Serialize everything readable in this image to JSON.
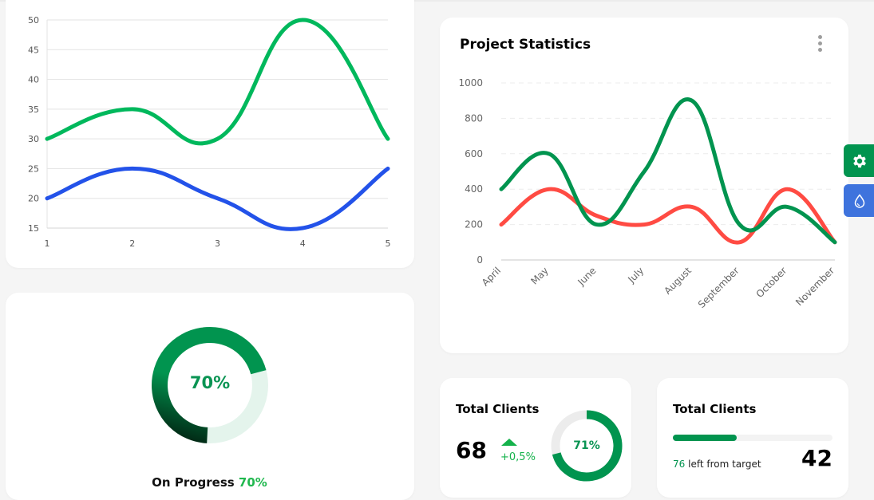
{
  "line_chart": {
    "chart_data": {
      "type": "line",
      "x": [
        1,
        2,
        3,
        4,
        5
      ],
      "series": [
        {
          "name": "series-green",
          "color": "#00b85c",
          "values": [
            30,
            35,
            30,
            50,
            30
          ]
        },
        {
          "name": "series-blue",
          "color": "#2352e9",
          "values": [
            20,
            25,
            20,
            15,
            25
          ]
        }
      ],
      "ylim": [
        15,
        50
      ],
      "yticks": [
        15,
        20,
        25,
        30,
        35,
        40,
        45,
        50
      ],
      "xticks": [
        "1",
        "2",
        "3",
        "4",
        "5"
      ],
      "title": "",
      "xlabel": "",
      "ylabel": "",
      "grid": true
    }
  },
  "progress_card": {
    "donut_value": 70,
    "donut_label": "70%",
    "caption_text": "On Progress",
    "caption_pct": "70%",
    "fill_color": "#01944f",
    "track_color": "#e4f4ec"
  },
  "project_statistics": {
    "title": "Project Statistics",
    "menu_icon": "kebab-menu-icon",
    "chart_data": {
      "type": "line",
      "categories": [
        "April",
        "May",
        "June",
        "July",
        "August",
        "September",
        "October",
        "November"
      ],
      "series": [
        {
          "name": "series-green",
          "color": "#01944f",
          "values": [
            400,
            600,
            200,
            500,
            900,
            200,
            300,
            100
          ]
        },
        {
          "name": "series-red",
          "color": "#ff4b43",
          "values": [
            200,
            400,
            250,
            200,
            300,
            100,
            400,
            100
          ]
        }
      ],
      "ylim": [
        0,
        1000
      ],
      "yticks": [
        0,
        200,
        400,
        600,
        800,
        1000
      ],
      "title": "",
      "xlabel": "",
      "ylabel": "",
      "grid": true
    }
  },
  "side_buttons": {
    "settings_icon": "gear-icon",
    "theme_icon": "drop-icon",
    "settings_color": "#01944f",
    "theme_color": "#3e73dd"
  },
  "clients_card_1": {
    "title": "Total Clients",
    "value": "68",
    "trend": "+0,5%",
    "trend_direction": "up",
    "donut_value": 71,
    "donut_label": "71%"
  },
  "clients_card_2": {
    "title": "Total Clients",
    "progress_fraction": 0.4,
    "left_number": "76",
    "left_text": "left from target",
    "value": "42"
  }
}
